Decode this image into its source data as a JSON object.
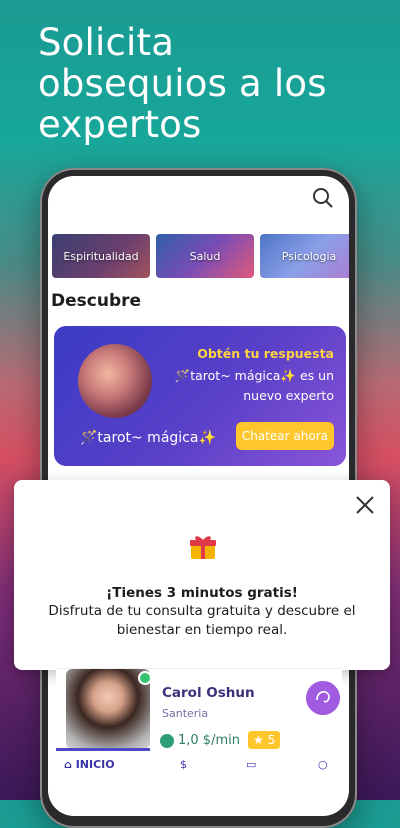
{
  "headline": [
    "Solicita",
    "obsequios a los",
    "expertos"
  ],
  "categories": [
    "Espiritualidad",
    "Salud",
    "Psicologia"
  ],
  "section_title": "Descubre",
  "promo": {
    "title": "Obtén tu respuesta",
    "line1": "🪄tarot~ mágica✨ es un",
    "line2": "nuevo experto",
    "expert_name": "🪄tarot~ mágica✨",
    "button": "Chatear ahora"
  },
  "modal": {
    "title": "¡Tienes 3 minutos gratis!",
    "text": "Disfruta de tu consulta gratuita y descubre el bienestar en tiempo real."
  },
  "expert_card": {
    "name": "Carol Oshun",
    "category": "Santeria",
    "price": "1,0 $/min",
    "rating": "5"
  },
  "tabbar": {
    "home": "INICIO"
  }
}
